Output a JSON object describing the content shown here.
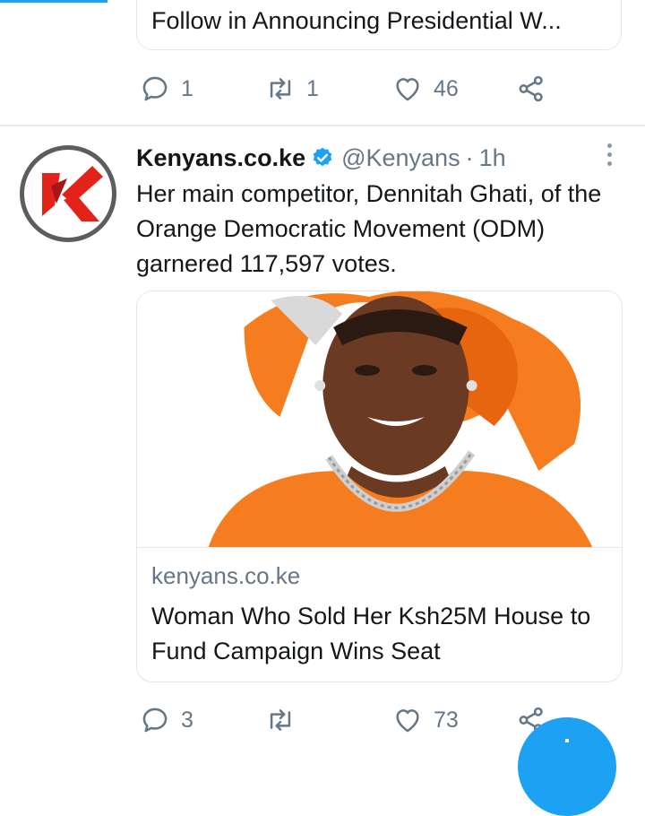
{
  "previous_tweet": {
    "card_title": "Follow in Announcing Presidential W...",
    "reply_count": "1",
    "retweet_count": "1",
    "like_count": "46"
  },
  "tweet": {
    "display_name": "Kenyans.co.ke",
    "handle": "@Kenyans",
    "separator": "·",
    "time": "1h",
    "text": "Her main competitor, Dennitah Ghati, of the Orange Democratic Movement (ODM) garnered 117,597 votes.",
    "card": {
      "domain": "kenyans.co.ke",
      "title": "Woman Who Sold Her Ksh25M House to Fund Campaign Wins Seat"
    },
    "reply_count": "3",
    "retweet_count": "",
    "like_count": "73"
  },
  "icons": {
    "reply": "reply-icon",
    "retweet": "retweet-icon",
    "like": "heart-icon",
    "share": "share-icon",
    "verified": "verified-badge-icon",
    "more": "more-options-icon"
  },
  "colors": {
    "accent": "#1da1f2",
    "secondary_text": "#657786",
    "logo_red": "#e2231a",
    "orange_garment": "#f57d1f"
  }
}
